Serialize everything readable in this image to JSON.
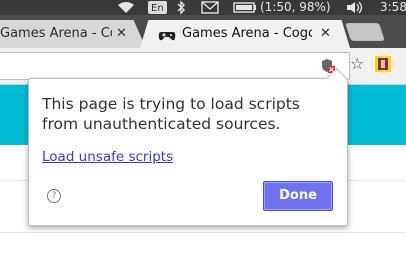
{
  "system_panel": {
    "keyboard_layout": "En",
    "battery": "(1:50, 98%)",
    "clock": "3:58"
  },
  "tabs": [
    {
      "title": "Games Arena - Cogc",
      "close": "✕"
    },
    {
      "title": "Games Arena - Cogc",
      "close": "✕"
    }
  ],
  "bubble": {
    "message": "This page is trying to load scripts from unauthenticated sources.",
    "link_text": "Load unsafe scripts",
    "help_glyph": "?",
    "done_label": "Done"
  },
  "colors": {
    "accent": "#6f73f0",
    "page_banner": "#00bcd4",
    "link": "#3a3ad8"
  }
}
